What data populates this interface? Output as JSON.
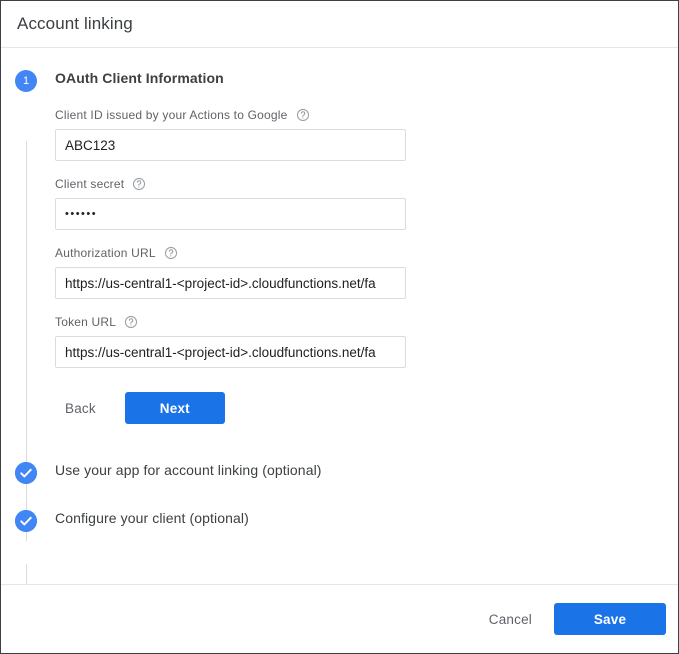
{
  "dialog": {
    "title": "Account linking"
  },
  "steps": [
    {
      "marker": "1",
      "marker_type": "number",
      "heading": "OAuth Client Information",
      "state": "active"
    },
    {
      "marker": "check-icon",
      "marker_type": "check",
      "heading": "Use your app for account linking (optional)",
      "state": "complete"
    },
    {
      "marker": "check-icon",
      "marker_type": "check",
      "heading": "Configure your client (optional)",
      "state": "complete"
    }
  ],
  "form": {
    "fields": [
      {
        "label": "Client ID issued by your Actions to Google",
        "help_icon": "help-circle-icon",
        "value": "ABC123",
        "placeholder": "",
        "type": "text"
      },
      {
        "label": "Client secret",
        "help_icon": "help-circle-icon",
        "value": "••••••",
        "placeholder": "",
        "type": "password"
      },
      {
        "label": "Authorization URL",
        "help_icon": "help-circle-icon",
        "value": "https://us-central1-<project-id>.cloudfunctions.net/fa",
        "placeholder": "",
        "type": "text"
      },
      {
        "label": "Token URL",
        "help_icon": "help-circle-icon",
        "value": "https://us-central1-<project-id>.cloudfunctions.net/fa",
        "placeholder": "",
        "type": "text"
      }
    ],
    "back_label": "Back",
    "next_label": "Next"
  },
  "footer": {
    "cancel_label": "Cancel",
    "save_label": "Save"
  },
  "colors": {
    "accent_blue": "#1b73e8",
    "marker_blue": "#4285f4",
    "label_gray": "#5f6368",
    "text_dark": "#3c4043",
    "border_gray": "#dadce0",
    "divider_gray": "#e4e6e8"
  }
}
